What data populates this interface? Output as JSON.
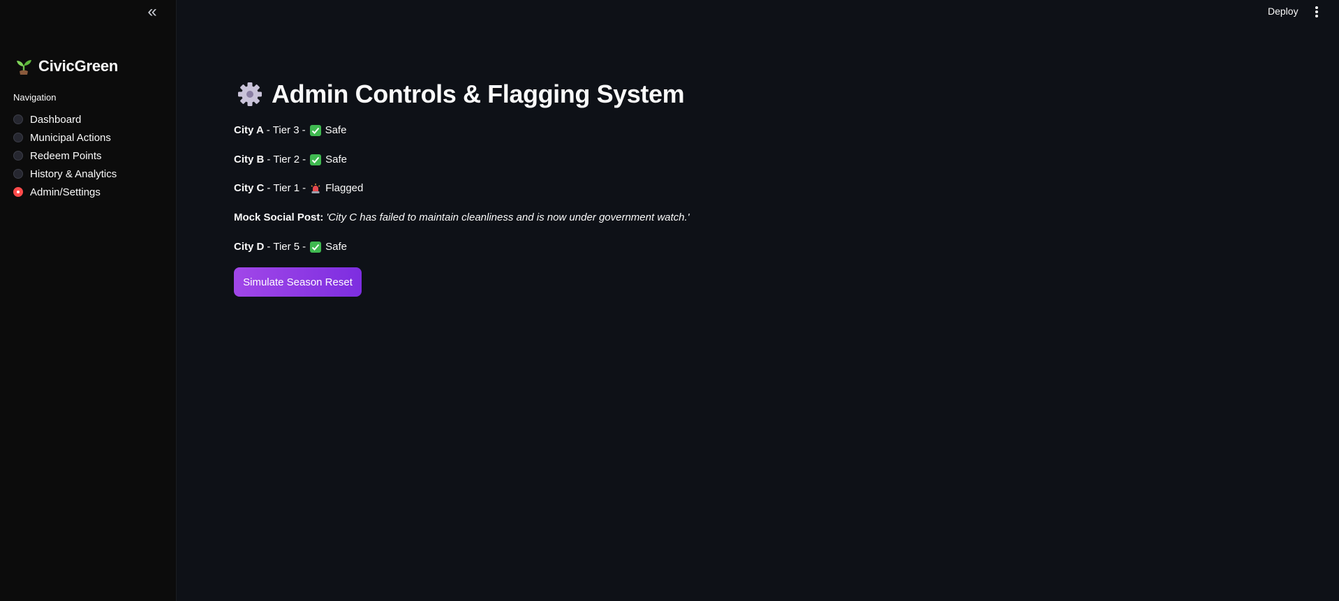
{
  "sidebar": {
    "collapse_icon": "double-chevron-left-icon",
    "brand": {
      "icon": "seedling-icon",
      "title": "CivicGreen"
    },
    "nav_label": "Navigation",
    "items": [
      {
        "label": "Dashboard",
        "selected": false
      },
      {
        "label": "Municipal Actions",
        "selected": false
      },
      {
        "label": "Redeem Points",
        "selected": false
      },
      {
        "label": "History & Analytics",
        "selected": false
      },
      {
        "label": "Admin/Settings",
        "selected": true
      }
    ]
  },
  "header": {
    "deploy_label": "Deploy",
    "menu_icon": "vertical-dots-icon"
  },
  "main": {
    "title_icon": "gear-icon",
    "title": "Admin Controls & Flagging System",
    "cities": [
      {
        "name": "City A",
        "tier": "Tier 3",
        "status_icon": "check-icon",
        "status": "Safe"
      },
      {
        "name": "City B",
        "tier": "Tier 2",
        "status_icon": "check-icon",
        "status": "Safe"
      },
      {
        "name": "City C",
        "tier": "Tier 1",
        "status_icon": "siren-icon",
        "status": "Flagged"
      },
      {
        "name": "City D",
        "tier": "Tier 5",
        "status_icon": "check-icon",
        "status": "Safe"
      }
    ],
    "separator": "-",
    "mock_post": {
      "label": "Mock Social Post:",
      "text": "'City C has failed to maintain cleanliness and is now under government watch.'"
    },
    "button_label": "Simulate Season Reset"
  },
  "colors": {
    "background": "#0e1117",
    "sidebar": "#0c0c0c",
    "accent_radio": "#ff4b4b",
    "button_start": "#a147e8",
    "button_end": "#7d2ee0",
    "check_green": "#3fb950",
    "siren_red": "#e5484d"
  }
}
